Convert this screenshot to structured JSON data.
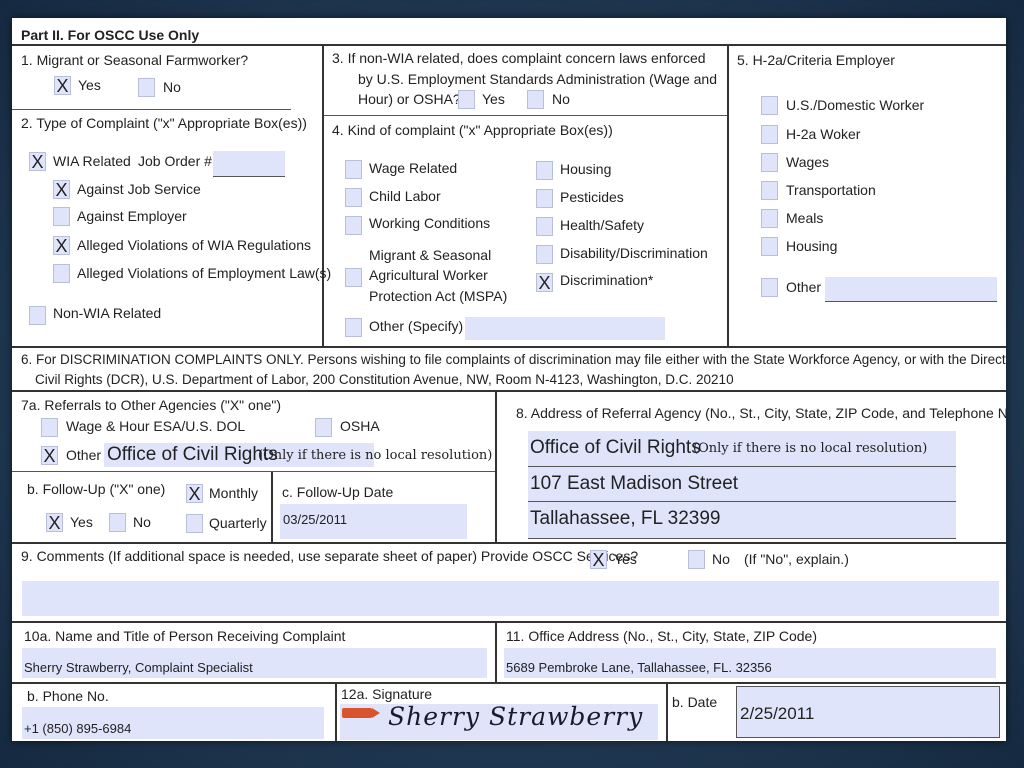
{
  "title": "Part II. For OSCC Use Only",
  "q1": {
    "label": "1. Migrant or Seasonal Farmworker?",
    "yes": "Yes",
    "no": "No",
    "yes_mark": "X",
    "no_mark": ""
  },
  "q2": {
    "label": "2. Type of Complaint (\"x\" Appropriate Box(es))",
    "wia_related": "WIA Related",
    "wia_mark": "X",
    "job_order": "Job Order #",
    "against_job_service": "Against Job Service",
    "against_job_service_mark": "X",
    "against_employer": "Against Employer",
    "against_employer_mark": "",
    "alleged_wia": "Alleged Violations of WIA Regulations",
    "alleged_wia_mark": "X",
    "alleged_employment": "Alleged Violations of Employment Law(s)",
    "alleged_employment_mark": "",
    "non_wia": "Non-WIA Related",
    "non_wia_mark": ""
  },
  "q3": {
    "line1": "3.    If non-WIA related, does complaint concern laws enforced",
    "line2": "by U.S. Employment Standards Administration (Wage and",
    "line3": "Hour) or OSHA?",
    "yes": "Yes",
    "no": "No"
  },
  "q4": {
    "label": "4. Kind of complaint (\"x\" Appropriate Box(es))",
    "wage_related": "Wage Related",
    "child_labor": "Child Labor",
    "working_conditions": "Working Conditions",
    "mspa_line1": "Migrant & Seasonal",
    "mspa_line2": "Agricultural Worker",
    "mspa_line3": "Protection Act (MSPA)",
    "other_specify": "Other (Specify)",
    "housing": "Housing",
    "pesticides": "Pesticides",
    "health_safety": "Health/Safety",
    "disability": "Disability/Discrimination",
    "discrimination": "Discrimination*",
    "discrimination_mark": "X"
  },
  "q5": {
    "label": "5.  H-2a/Criteria Employer",
    "items": [
      "U.S./Domestic Worker",
      "H-2a Woker",
      "Wages",
      "Transportation",
      "Meals",
      "Housing"
    ],
    "other": "Other"
  },
  "q6": {
    "line1": "6. For DISCRIMINATION COMPLAINTS ONLY. Persons wishing to file complaints of discrimination may file either with the State Workforce Agency, or with the Directorate of",
    "line2": "Civil Rights (DCR), U.S. Department of Labor, 200 Constitution Avenue, NW, Room N-4123, Washington, D.C. 20210"
  },
  "q7a": {
    "label": "7a. Referrals to Other Agencies (\"X\" one\")",
    "wage_hour": "Wage & Hour ESA/U.S. DOL",
    "osha": "OSHA",
    "other": "Other",
    "other_mark": "X",
    "other_value": "Office of Civil Rights",
    "other_note": "(Only if there is no local resolution)"
  },
  "q7b": {
    "label": "b.  Follow-Up (\"X\" one)",
    "monthly": "Monthly",
    "monthly_mark": "X",
    "quarterly": "Quarterly",
    "yes": "Yes",
    "yes_mark": "X",
    "no": "No"
  },
  "q7c": {
    "label": "c.  Follow-Up Date",
    "value": "03/25/2011"
  },
  "q8": {
    "label": "8.  Address of Referral Agency (No., St., City, State, ZIP Code, and Telephone No.)",
    "line1": "Office of Civil Rights",
    "note": "(Only if there is no local resolution)",
    "line2": "107 East Madison Street",
    "line3": "Tallahassee, FL 32399"
  },
  "q9": {
    "label": "9.  Comments (If additional space is needed, use separate sheet of paper)  Provide OSCC Services?",
    "yes": "Yes",
    "yes_mark": "X",
    "no": "No",
    "explain": "(If \"No\", explain.)"
  },
  "q10a": {
    "label": "10a.  Name and Title of Person Receiving Complaint",
    "value": "Sherry Strawberry, Complaint Specialist"
  },
  "q11": {
    "label": "11.  Office Address (No., St., City, State, ZIP Code)",
    "value": "5689 Pembroke Lane, Tallahassee, FL. 32356"
  },
  "q10b": {
    "label": "b. Phone No.",
    "value": "+1 (850) 895-6984"
  },
  "q12a": {
    "label": "12a. Signature",
    "value": "Sherry Strawberry"
  },
  "q12b": {
    "label": "b. Date",
    "value": "2/25/2011"
  }
}
